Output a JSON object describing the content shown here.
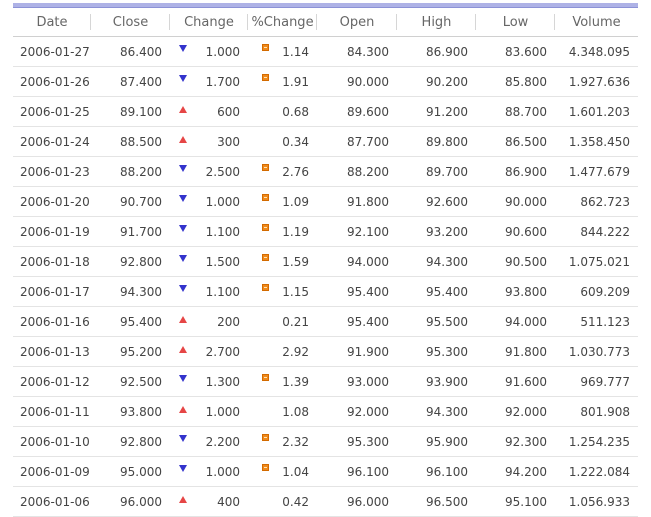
{
  "columns": [
    "Date",
    "Close",
    "Change",
    "%Change",
    "Open",
    "High",
    "Low",
    "Volume"
  ],
  "colors": {
    "up": "#e64545",
    "down": "#3333cc",
    "marker": "#f08a1c",
    "header_bar": "#aeb2e6"
  },
  "rows": [
    {
      "date": "2006-01-27",
      "close": "86.400",
      "dir": "down",
      "change": "1.000",
      "marker": true,
      "pct": "1.14",
      "open": "84.300",
      "high": "86.900",
      "low": "83.600",
      "volume": "4.348.095"
    },
    {
      "date": "2006-01-26",
      "close": "87.400",
      "dir": "down",
      "change": "1.700",
      "marker": true,
      "pct": "1.91",
      "open": "90.000",
      "high": "90.200",
      "low": "85.800",
      "volume": "1.927.636"
    },
    {
      "date": "2006-01-25",
      "close": "89.100",
      "dir": "up",
      "change": "600",
      "marker": false,
      "pct": "0.68",
      "open": "89.600",
      "high": "91.200",
      "low": "88.700",
      "volume": "1.601.203"
    },
    {
      "date": "2006-01-24",
      "close": "88.500",
      "dir": "up",
      "change": "300",
      "marker": false,
      "pct": "0.34",
      "open": "87.700",
      "high": "89.800",
      "low": "86.500",
      "volume": "1.358.450"
    },
    {
      "date": "2006-01-23",
      "close": "88.200",
      "dir": "down",
      "change": "2.500",
      "marker": true,
      "pct": "2.76",
      "open": "88.200",
      "high": "89.700",
      "low": "86.900",
      "volume": "1.477.679"
    },
    {
      "date": "2006-01-20",
      "close": "90.700",
      "dir": "down",
      "change": "1.000",
      "marker": true,
      "pct": "1.09",
      "open": "91.800",
      "high": "92.600",
      "low": "90.000",
      "volume": "862.723"
    },
    {
      "date": "2006-01-19",
      "close": "91.700",
      "dir": "down",
      "change": "1.100",
      "marker": true,
      "pct": "1.19",
      "open": "92.100",
      "high": "93.200",
      "low": "90.600",
      "volume": "844.222"
    },
    {
      "date": "2006-01-18",
      "close": "92.800",
      "dir": "down",
      "change": "1.500",
      "marker": true,
      "pct": "1.59",
      "open": "94.000",
      "high": "94.300",
      "low": "90.500",
      "volume": "1.075.021"
    },
    {
      "date": "2006-01-17",
      "close": "94.300",
      "dir": "down",
      "change": "1.100",
      "marker": true,
      "pct": "1.15",
      "open": "95.400",
      "high": "95.400",
      "low": "93.800",
      "volume": "609.209"
    },
    {
      "date": "2006-01-16",
      "close": "95.400",
      "dir": "up",
      "change": "200",
      "marker": false,
      "pct": "0.21",
      "open": "95.400",
      "high": "95.500",
      "low": "94.000",
      "volume": "511.123"
    },
    {
      "date": "2006-01-13",
      "close": "95.200",
      "dir": "up",
      "change": "2.700",
      "marker": false,
      "pct": "2.92",
      "open": "91.900",
      "high": "95.300",
      "low": "91.800",
      "volume": "1.030.773"
    },
    {
      "date": "2006-01-12",
      "close": "92.500",
      "dir": "down",
      "change": "1.300",
      "marker": true,
      "pct": "1.39",
      "open": "93.000",
      "high": "93.900",
      "low": "91.600",
      "volume": "969.777"
    },
    {
      "date": "2006-01-11",
      "close": "93.800",
      "dir": "up",
      "change": "1.000",
      "marker": false,
      "pct": "1.08",
      "open": "92.000",
      "high": "94.300",
      "low": "92.000",
      "volume": "801.908"
    },
    {
      "date": "2006-01-10",
      "close": "92.800",
      "dir": "down",
      "change": "2.200",
      "marker": true,
      "pct": "2.32",
      "open": "95.300",
      "high": "95.900",
      "low": "92.300",
      "volume": "1.254.235"
    },
    {
      "date": "2006-01-09",
      "close": "95.000",
      "dir": "down",
      "change": "1.000",
      "marker": true,
      "pct": "1.04",
      "open": "96.100",
      "high": "96.100",
      "low": "94.200",
      "volume": "1.222.084"
    },
    {
      "date": "2006-01-06",
      "close": "96.000",
      "dir": "up",
      "change": "400",
      "marker": false,
      "pct": "0.42",
      "open": "96.000",
      "high": "96.500",
      "low": "95.100",
      "volume": "1.056.933"
    }
  ]
}
